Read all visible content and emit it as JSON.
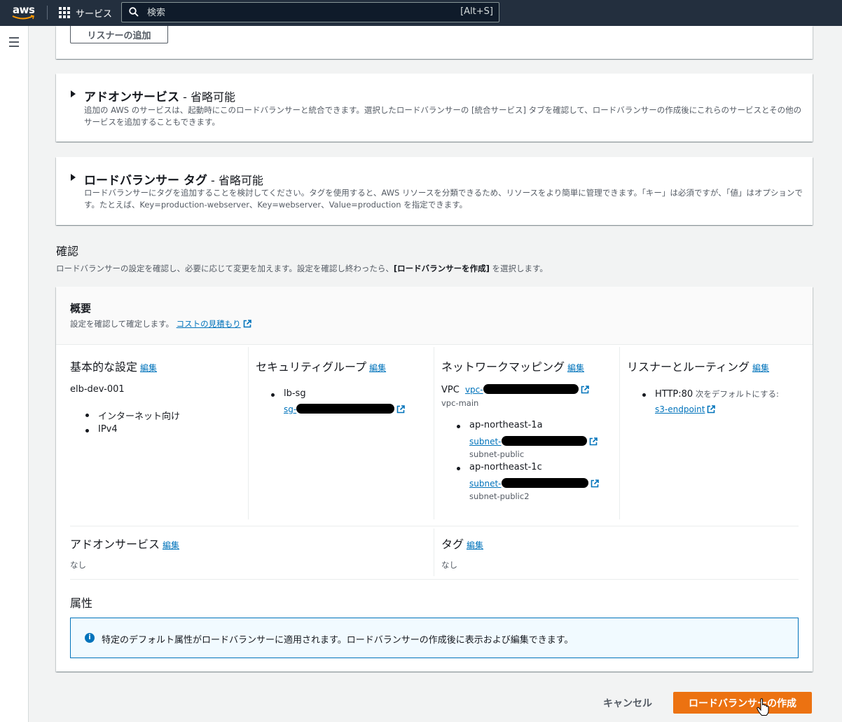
{
  "topbar": {
    "logo_text": "aws",
    "services_label": "サービス",
    "search_placeholder": "検索",
    "search_shortcut": "[Alt+S]"
  },
  "listener": {
    "add_button": "リスナーの追加"
  },
  "addon_section": {
    "title": "アドオンサービス",
    "optional": " - 省略可能",
    "description": "追加の AWS のサービスは、起動時にこのロードバランサーと統合できます。選択したロードバランサーの [統合サービス] タブを確認して、ロードバランサーの作成後にこれらのサービスとその他のサービスを追加することもできます。"
  },
  "tags_section": {
    "title": "ロードバランサー タグ",
    "optional": " - 省略可能",
    "description": "ロードバランサーにタグを追加することを検討してください。タグを使用すると、AWS リソースを分類できるため、リソースをより簡単に管理できます。「キー」は必須ですが、「値」はオプションです。たとえば、Key=production-webserver、Key=webserver、Value=production を指定できます。"
  },
  "review": {
    "heading": "確認",
    "desc_before": "ロードバランサーの設定を確認し、必要に応じて変更を加えます。設定を確認し終わったら、",
    "desc_bold": "[ロードバランサーを作成]",
    "desc_after": " を選択します。"
  },
  "summary": {
    "title": "概要",
    "description": "設定を確認して確定します。",
    "cost_link": "コストの見積もり",
    "edit_label": "編集",
    "basic": {
      "heading": "基本的な設定",
      "name": "elb-dev-001",
      "items": [
        "インターネット向け",
        "IPv4"
      ]
    },
    "security": {
      "heading": "セキュリティグループ",
      "group_name": "lb-sg",
      "group_link": "sg-"
    },
    "network": {
      "heading": "ネットワークマッピング",
      "vpc_label": "VPC",
      "vpc_link": "vpc-",
      "vpc_name": "vpc-main",
      "zones": [
        {
          "az": "ap-northeast-1a",
          "subnet_link": "subnet-",
          "subnet_name": "subnet-public"
        },
        {
          "az": "ap-northeast-1c",
          "subnet_link": "subnet-",
          "subnet_name": "subnet-public2"
        }
      ]
    },
    "listener": {
      "heading": "リスナーとルーティング",
      "rule_bold": "HTTP:80",
      "rule_text": " 次をデフォルトにする:",
      "target_link": "s3-endpoint"
    },
    "addons": {
      "heading": "アドオンサービス",
      "value": "なし"
    },
    "tags": {
      "heading": "タグ",
      "value": "なし"
    },
    "attributes": {
      "heading": "属性",
      "info": "特定のデフォルト属性がロードバランサーに適用されます。ロードバランサーの作成後に表示および編集できます。"
    }
  },
  "footer": {
    "cancel": "キャンセル",
    "create": "ロードバランサーの作成"
  },
  "colors": {
    "topbar": "#232f3e",
    "link": "#0073bb",
    "primary": "#ec7211",
    "info_border": "#0073bb"
  }
}
